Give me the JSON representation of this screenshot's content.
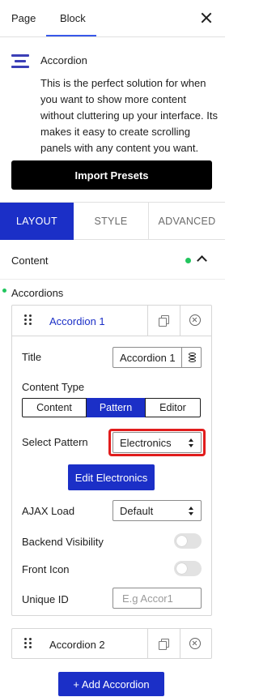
{
  "header": {
    "tabs": [
      "Page",
      "Block"
    ],
    "active_tab": "Block"
  },
  "block": {
    "title": "Accordion",
    "description": "This is the perfect solution for when you want to show more content without cluttering up your interface. Its makes it easy to create scrolling panels with any content you want.",
    "import_label": "Import Presets"
  },
  "panel_tabs": {
    "layout": "LAYOUT",
    "style": "STYLE",
    "advanced": "ADVANCED",
    "active": "LAYOUT"
  },
  "content_section": {
    "label": "Content",
    "expanded": true
  },
  "accordions": {
    "label": "Accordions",
    "items": [
      {
        "label": "Accordion 1",
        "expanded": true,
        "fields": {
          "title_label": "Title",
          "title_value": "Accordion 1",
          "content_type_label": "Content Type",
          "content_type_options": [
            "Content",
            "Pattern",
            "Editor"
          ],
          "content_type_selected": "Pattern",
          "select_pattern_label": "Select Pattern",
          "select_pattern_value": "Electronics",
          "edit_button_label": "Edit Electronics",
          "ajax_label": "AJAX Load",
          "ajax_value": "Default",
          "backend_visibility_label": "Backend Visibility",
          "backend_visibility_on": false,
          "front_icon_label": "Front Icon",
          "front_icon_on": false,
          "unique_id_label": "Unique ID",
          "unique_id_placeholder": "E.g Accor1"
        }
      },
      {
        "label": "Accordion 2",
        "expanded": false
      }
    ],
    "add_label": "+ Add Accordion"
  },
  "colors": {
    "accent": "#1b2fc7",
    "highlight": "#e11d1d",
    "indicator": "#22c55e"
  }
}
